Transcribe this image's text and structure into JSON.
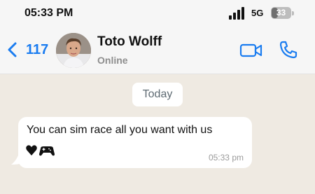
{
  "status_bar": {
    "time": "05:33 PM",
    "network": "5G",
    "battery": "33",
    "battery_level": 0.33
  },
  "header": {
    "back_count": "117",
    "contact_name": "Toto Wolff",
    "contact_status": "Online",
    "icons": [
      "chevron-left-icon",
      "video-camera-icon",
      "phone-icon"
    ],
    "accent_color": "#1a7cf0"
  },
  "chat": {
    "date_label": "Today",
    "messages": [
      {
        "text": "You can sim race all you want with us",
        "emoji": [
          "black-heart-emoji",
          "game-controller-emoji"
        ],
        "time": "05:33 pm"
      }
    ]
  }
}
